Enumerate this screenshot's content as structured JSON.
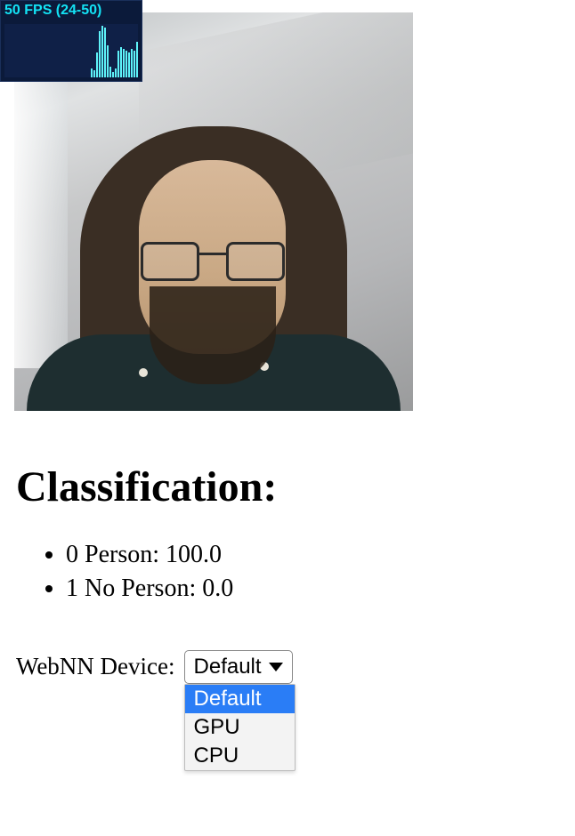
{
  "fps_overlay": {
    "text": "50 FPS (24-50)",
    "bars": [
      10,
      8,
      28,
      52,
      58,
      56,
      36,
      12,
      6,
      10,
      30,
      34,
      32,
      30,
      28,
      32,
      30,
      40
    ]
  },
  "heading": "Classification:",
  "classes": [
    {
      "index": 0,
      "label": "Person",
      "score": "100.0"
    },
    {
      "index": 1,
      "label": "No Person",
      "score": "0.0"
    }
  ],
  "device": {
    "label": "WebNN Device:",
    "selected": "Default",
    "options": [
      "Default",
      "GPU",
      "CPU"
    ]
  }
}
